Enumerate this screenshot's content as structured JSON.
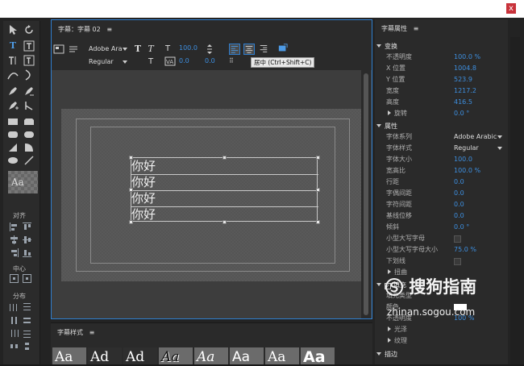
{
  "window": {
    "close_label": "x"
  },
  "tools": {
    "swatch_label": "Aa",
    "align_label": "对齐",
    "center_label": "中心",
    "distribute_label": "分布"
  },
  "title_panel": {
    "tab_label": "字幕：字幕 02",
    "menu_icon": "≡",
    "font_family": "Adobe Ara",
    "font_style": "Regular",
    "font_size": "100.0",
    "kerning": "0.0",
    "leading": "0.0",
    "tooltip": "居中 (Ctrl+Shift+C)",
    "lines": [
      "你好",
      "你好",
      "你好",
      "你好"
    ]
  },
  "styles_panel": {
    "tab_label": "字幕样式",
    "menu_icon": "≡",
    "samples": [
      "Aa",
      "Ad",
      "Ad",
      "Aa",
      "Aa",
      "Aa",
      "Aa",
      "Aa"
    ]
  },
  "properties": {
    "tab_label": "字幕属性",
    "menu_icon": "≡",
    "transform_group": "变换",
    "opacity_label": "不透明度",
    "opacity_value": "100.0 %",
    "x_label": "X 位置",
    "x_value": "1004.8",
    "y_label": "Y 位置",
    "y_value": "523.9",
    "width_label": "宽度",
    "width_value": "1217.2",
    "height_label": "高度",
    "height_value": "416.5",
    "rotation_label": "旋转",
    "rotation_value": "0.0 °",
    "attributes_group": "属性",
    "font_family_label": "字体系列",
    "font_family_value": "Adobe Arabic",
    "font_style_label": "字体样式",
    "font_style_value": "Regular",
    "font_size_label": "字体大小",
    "font_size_value": "100.0",
    "aspect_label": "宽高比",
    "aspect_value": "100.0 %",
    "leading_label": "行距",
    "leading_value": "0.0",
    "kerning_label": "字偶间距",
    "kerning_value": "0.0",
    "tracking_label": "字符间距",
    "tracking_value": "0.0",
    "baseline_label": "基线位移",
    "baseline_value": "0.0",
    "slant_label": "倾斜",
    "slant_value": "0.0 °",
    "smallcaps_label": "小型大写字母",
    "smallcaps_size_label": "小型大写字母大小",
    "smallcaps_size_value": "75.0 %",
    "underline_label": "下划线",
    "distort_label": "扭曲",
    "fill_group": "填充",
    "fill_type_label": "填充类型",
    "fill_color_label": "颜色",
    "fill_opacity_label": "不透明度",
    "fill_opacity_value": "100 %",
    "sheen_label": "光泽",
    "texture_label": "纹理",
    "stroke_group": "描边"
  },
  "watermark": {
    "brand": "搜狗指南",
    "url": "zhinan.sogou.com"
  },
  "colors": {
    "accent": "#2f7fd0",
    "value_blue": "#3d8fe0",
    "close_red": "#c8323a"
  }
}
